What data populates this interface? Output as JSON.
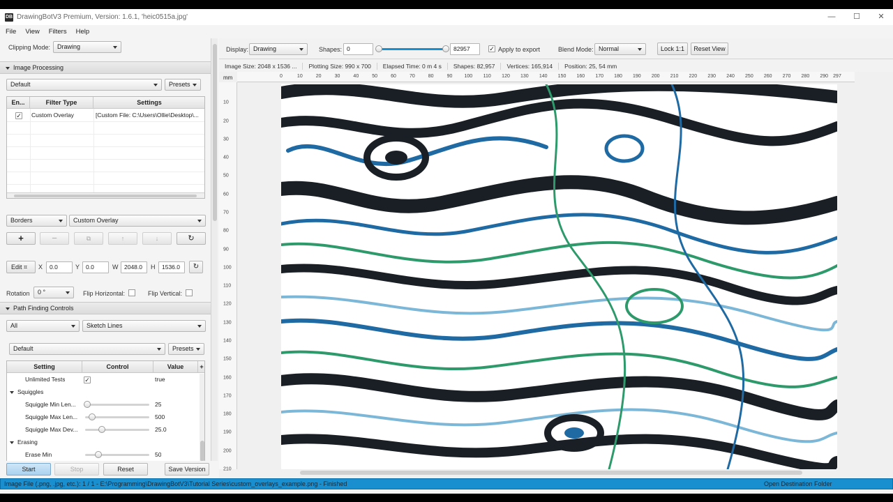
{
  "window": {
    "title": "DrawingBotV3 Premium, Version: 1.6.1, 'heic0515a.jpg'",
    "icon_text": "DB"
  },
  "menu": [
    "File",
    "View",
    "Filters",
    "Help"
  ],
  "left": {
    "clipping_label": "Clipping Mode:",
    "clipping_value": "Drawing",
    "image_processing": "Image Processing",
    "preset_default": "Default",
    "presets_label": "Presets",
    "filter_table": {
      "headers": [
        "En...",
        "Filter Type",
        "Settings"
      ],
      "rows": [
        {
          "enabled": true,
          "type": "Custom Overlay",
          "settings": "[Custom File: C:\\Users\\Ollie\\Desktop\\..."
        }
      ]
    },
    "filter_category": "Borders",
    "filter_choice": "Custom Overlay",
    "edit_label": "Edit",
    "crop": {
      "x_label": "X",
      "x": "0.0",
      "y_label": "Y",
      "y": "0.0",
      "w_label": "W",
      "w": "2048.0",
      "h_label": "H",
      "h": "1536.0"
    },
    "rotation_label": "Rotation",
    "rotation_value": "0 °",
    "flip_h": "Flip Horizontal:",
    "flip_v": "Flip Vertical:",
    "path_finding": "Path Finding Controls",
    "pfm_category": "All",
    "pfm_type": "Sketch Lines",
    "pfm_preset": "Default",
    "pfm_presets_label": "Presets",
    "settings_table": {
      "headers": [
        "Setting",
        "Control",
        "Value"
      ],
      "rows": [
        {
          "kind": "setting",
          "name": "Unlimited Tests",
          "control": "checkbox",
          "value": "true"
        },
        {
          "kind": "group",
          "name": "Squiggles"
        },
        {
          "kind": "setting",
          "name": "Squiggle Min Len...",
          "control": "slider",
          "level": 0.02,
          "value": "25"
        },
        {
          "kind": "setting",
          "name": "Squiggle Max Len...",
          "control": "slider",
          "level": 0.1,
          "value": "500"
        },
        {
          "kind": "setting",
          "name": "Squiggle Max Dev...",
          "control": "slider",
          "level": 0.25,
          "value": "25.0"
        },
        {
          "kind": "group",
          "name": "Erasing"
        },
        {
          "kind": "setting",
          "name": "Erase Min",
          "control": "slider",
          "level": 0.2,
          "value": "50"
        }
      ]
    },
    "buttons": {
      "start": "Start",
      "stop": "Stop",
      "reset": "Reset",
      "save_version": "Save Version"
    }
  },
  "toolbar": {
    "display_label": "Display:",
    "display_value": "Drawing",
    "shapes_label": "Shapes:",
    "shapes_min": "0",
    "shapes_max": "82957",
    "apply_export": "Apply to export",
    "blend_label": "Blend Mode:",
    "blend_value": "Normal",
    "lock": "Lock 1:1",
    "reset_view": "Reset View"
  },
  "info": {
    "image_size": "Image Size: 2048 x 1536 ...",
    "plotting_size": "Plotting Size: 990 x 700",
    "elapsed": "Elapsed Time: 0 m 4 s",
    "shapes": "Shapes: 82,957",
    "vertices": "Vertices: 165,914",
    "position": "Position: 25, 54 mm"
  },
  "ruler": {
    "unit": "mm",
    "top": [
      "0",
      "10",
      "20",
      "30",
      "40",
      "50",
      "60",
      "70",
      "80",
      "90",
      "100",
      "110",
      "120",
      "130",
      "140",
      "150",
      "160",
      "170",
      "180",
      "190",
      "200",
      "210",
      "220",
      "230",
      "240",
      "250",
      "260",
      "270",
      "280",
      "290",
      "297"
    ],
    "left": [
      "10",
      "20",
      "30",
      "40",
      "50",
      "60",
      "70",
      "80",
      "90",
      "100",
      "110",
      "120",
      "130",
      "140",
      "150",
      "160",
      "170",
      "180",
      "190",
      "200",
      "210"
    ]
  },
  "status": {
    "text": "Image File (.png, .jpg, etc.): 1 / 1 - E:\\Programming\\DrawingBotV3\\Tutorial Series\\custom_overlays_example.png - Finished",
    "open_folder": "Open Destination Folder"
  },
  "colors": {
    "accent": "#1a8fd0",
    "dark_ink": "#1a1f26",
    "blue_ink": "#1f6aa3",
    "green_ink": "#2e9a6b",
    "light_blue": "#7cb7d8"
  }
}
